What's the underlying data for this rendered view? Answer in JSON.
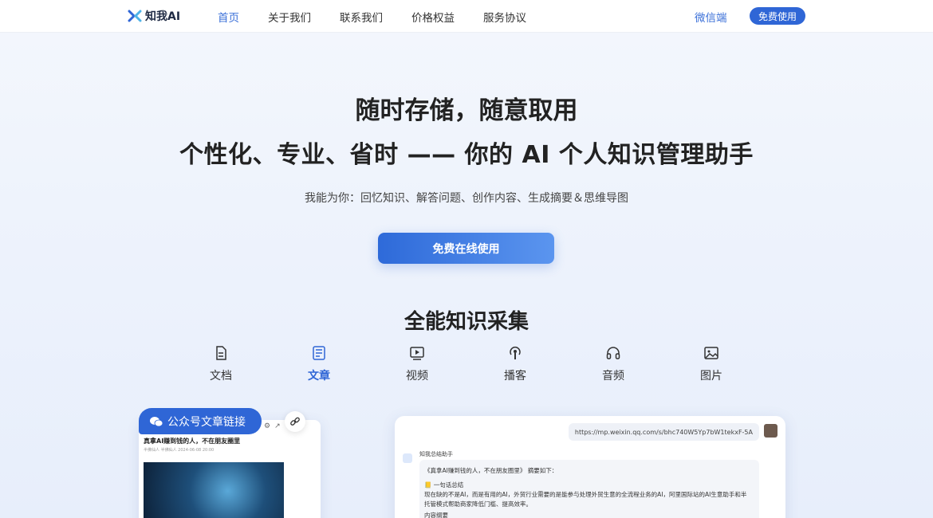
{
  "nav": {
    "logo_text": "知我AI",
    "links": [
      "首页",
      "关于我们",
      "联系我们",
      "价格权益",
      "服务协议"
    ],
    "wechat": "微信端",
    "cta": "免费使用"
  },
  "hero": {
    "title": "随时存储，随意取用",
    "subtitle": "个性化、专业、省时 —— 你的 AI 个人知识管理助手",
    "description": "我能为你：回忆知识、解答问题、创作内容、生成摘要＆思维导图",
    "button": "免费在线使用"
  },
  "section": {
    "title": "全能知识采集",
    "tabs": [
      {
        "label": "文档",
        "icon": "document-icon"
      },
      {
        "label": "文章",
        "icon": "article-icon"
      },
      {
        "label": "视频",
        "icon": "video-icon"
      },
      {
        "label": "播客",
        "icon": "podcast-icon"
      },
      {
        "label": "音频",
        "icon": "headphones-icon"
      },
      {
        "label": "图片",
        "icon": "image-icon"
      }
    ],
    "active_tab": "文章"
  },
  "left_card": {
    "pill_label": "公众号文章链接",
    "article_title": "真拿AI赚到钱的人，不在朋友圈里",
    "article_meta": "半佛仙人  半佛仙人  2024-06-08 20:00"
  },
  "right_card": {
    "url": "https://mp.weixin.qq.com/s/bhc740W5Yp7bW1tekxF-5A",
    "bot_name": "知我总结助手",
    "summary_head": "《真拿AI赚到钱的人，不在朋友圈里》 摘要如下：",
    "section_label": "一句话总结",
    "summary_text_1": "现在缺的不是AI，而是有用的AI，外贸行业需要的是能参与处理外贸生意的全流程业务的AI，阿里国际站的AI生意助手和半",
    "summary_text_2": "托管模式帮助商家降低门槛、提高效率。",
    "next_label": "内容纲要"
  },
  "colors": {
    "accent": "#2f66d6",
    "text": "#222222"
  }
}
